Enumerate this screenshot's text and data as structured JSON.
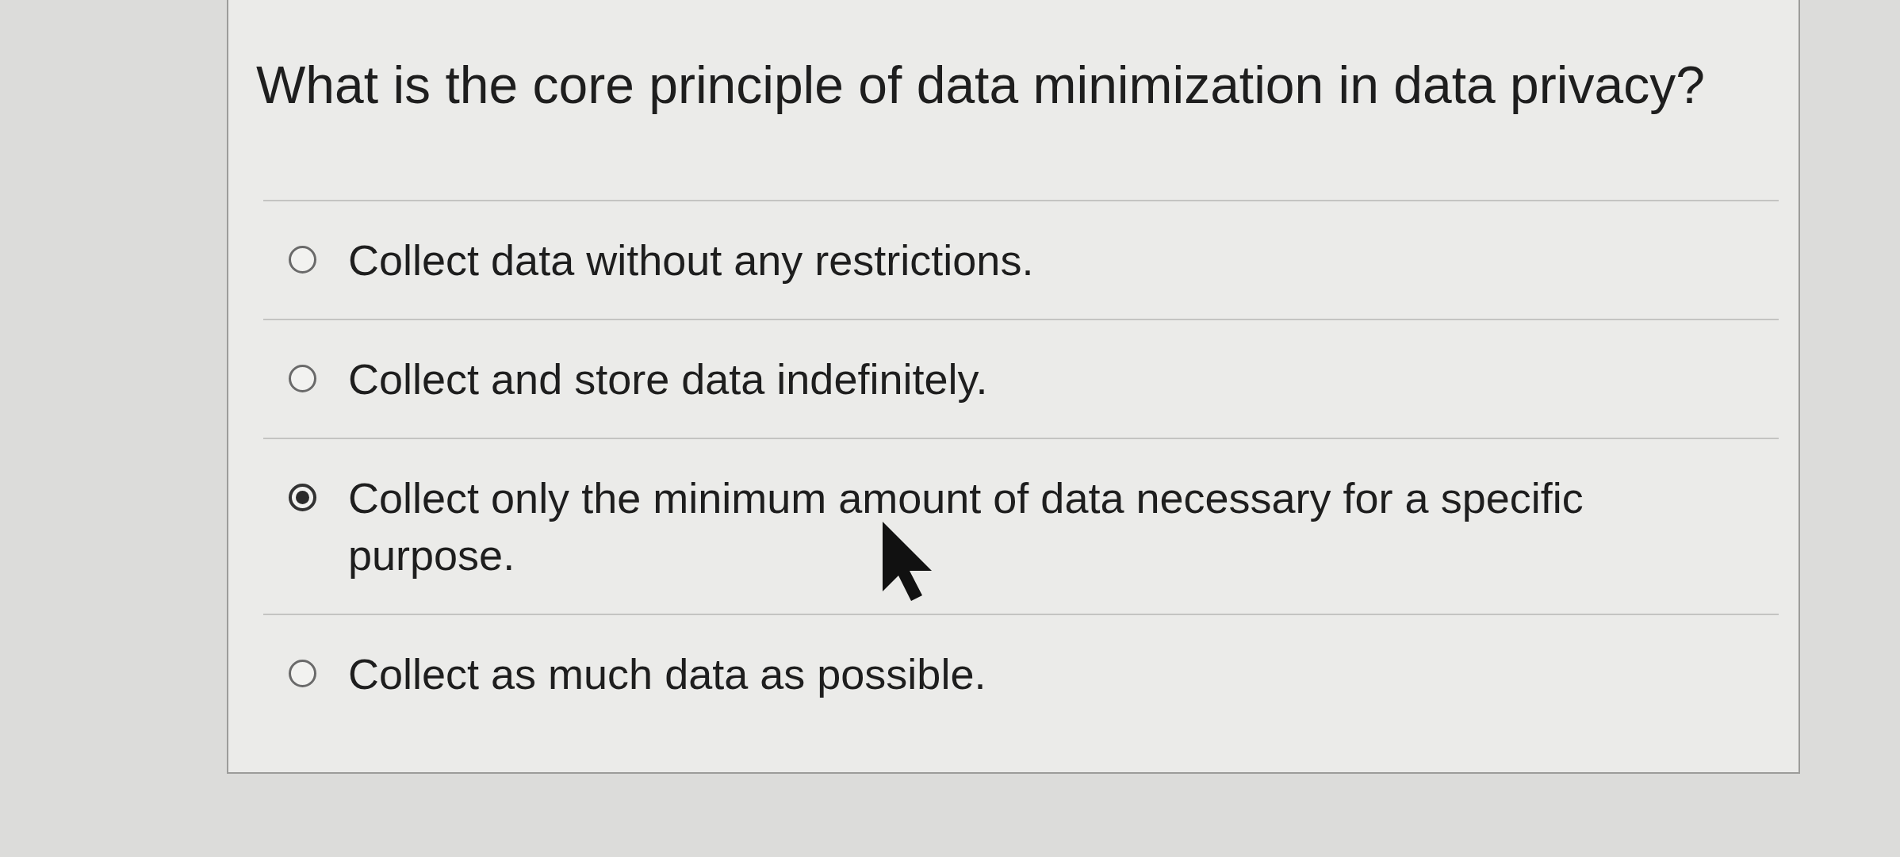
{
  "question": {
    "text": "What is the core principle of data minimization in data privacy?"
  },
  "options": [
    {
      "label": "Collect data without any restrictions.",
      "selected": false,
      "hovered": false
    },
    {
      "label": "Collect and store data indefinitely.",
      "selected": false,
      "hovered": false
    },
    {
      "label": "Collect only the minimum amount of data necessary for a specific purpose.",
      "selected": true,
      "hovered": true
    },
    {
      "label": "Collect as much data as possible.",
      "selected": false,
      "hovered": false
    }
  ]
}
